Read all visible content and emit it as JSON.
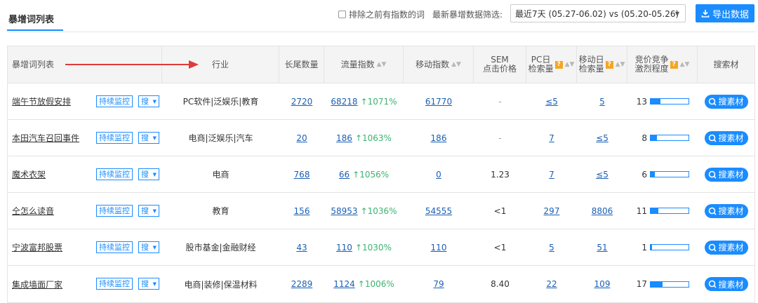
{
  "header": {
    "title": "暴增词列表",
    "exclude_label": "排除之前有指数的词",
    "filter_label": "最新暴增数据筛选:",
    "filter_value": "最近7天 (05.27-06.02) vs (05.20-05.26)",
    "export_label": "导出数据"
  },
  "columns": {
    "keyword": "暴增词列表",
    "industry": "行业",
    "longtail": "长尾数量",
    "traffic": "流量指数",
    "mobile": "移动指数",
    "sem_line1": "SEM",
    "sem_line2": "点击价格",
    "pc_line1": "PC日",
    "pc_line2": "检索量",
    "mob_line1": "移动日",
    "mob_line2": "检索量",
    "comp_line1": "竞价竞争",
    "comp_line2": "激烈程度",
    "material": "搜索材"
  },
  "buttons": {
    "monitor": "持续监控",
    "sou": "搜",
    "sucai": "搜素材"
  },
  "rows": [
    {
      "keyword": "端午节放假安排",
      "industry": "PC软件|泛娱乐|教育",
      "longtail": "2720",
      "traffic": "68218",
      "growth": "1071%",
      "mobile": "61770",
      "sem": "-",
      "pc": "≤5",
      "mob": "5",
      "comp": "13",
      "comp_level": 0.25
    },
    {
      "keyword": "本田汽车召回事件",
      "industry": "电商|泛娱乐|汽车",
      "longtail": "20",
      "traffic": "186",
      "growth": "1063%",
      "mobile": "186",
      "sem": "-",
      "pc": "7",
      "mob": "≤5",
      "comp": "8",
      "comp_level": 0.17
    },
    {
      "keyword": "魔术衣架",
      "industry": "电商",
      "longtail": "768",
      "traffic": "66",
      "growth": "1056%",
      "mobile": "0",
      "sem": "1.23",
      "pc": "7",
      "mob": "≤5",
      "comp": "6",
      "comp_level": 0.12
    },
    {
      "keyword": "仝怎么读音",
      "industry": "教育",
      "longtail": "156",
      "traffic": "58953",
      "growth": "1036%",
      "mobile": "54555",
      "sem": "<1",
      "pc": "297",
      "mob": "8806",
      "comp": "11",
      "comp_level": 0.21
    },
    {
      "keyword": "宁波富邦股票",
      "industry": "股市基金|金融财经",
      "longtail": "43",
      "traffic": "110",
      "growth": "1030%",
      "mobile": "110",
      "sem": "<1",
      "pc": "5",
      "mob": "51",
      "comp": "1",
      "comp_level": 0.04
    },
    {
      "keyword": "集成墙面厂家",
      "industry": "电商|装修|保温材料",
      "longtail": "2289",
      "traffic": "1124",
      "growth": "1006%",
      "mobile": "79",
      "sem": "8.40",
      "pc": "22",
      "mob": "109",
      "comp": "17",
      "comp_level": 0.32
    }
  ],
  "colors": {
    "accent": "#1a8cff",
    "growth": "#3cb371",
    "arrow": "#e03a3a",
    "help_badge": "#f5a623"
  }
}
